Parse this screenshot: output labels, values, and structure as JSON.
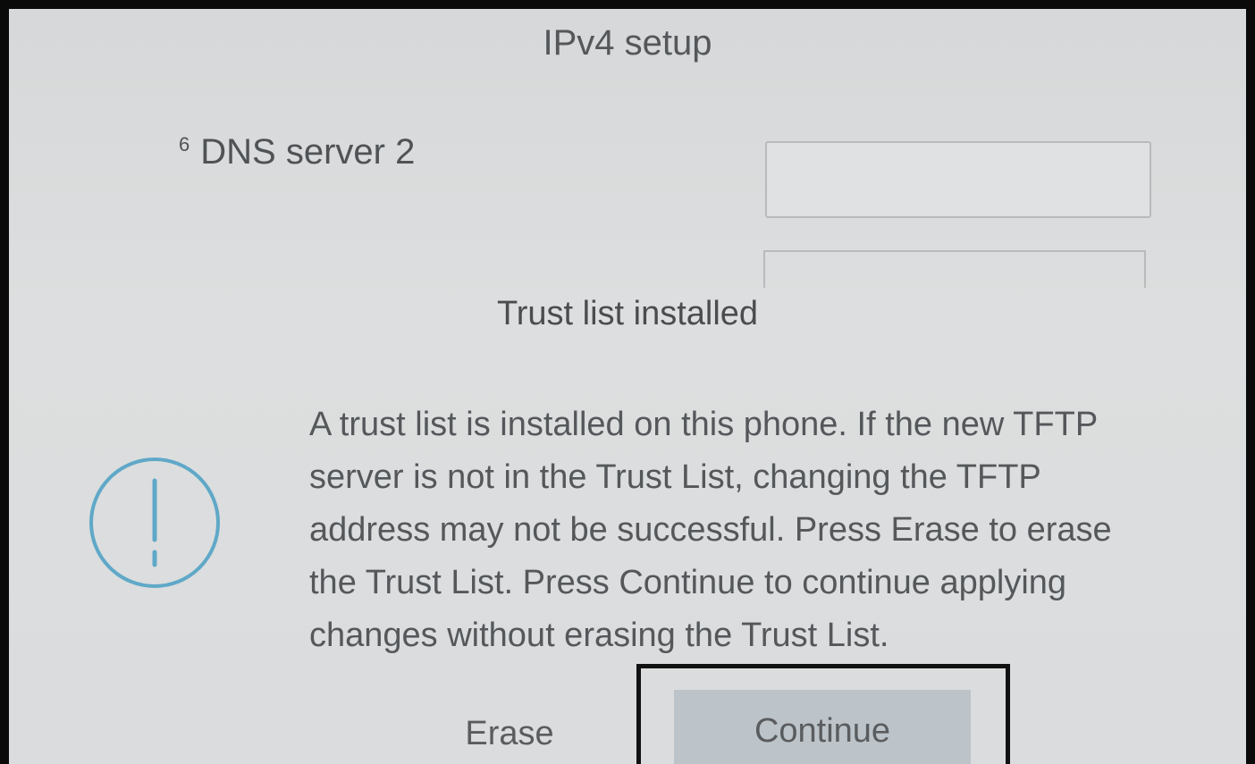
{
  "header": {
    "title": "IPv4 setup"
  },
  "field": {
    "index": "6",
    "label": "DNS server 2",
    "value": ""
  },
  "dialog": {
    "title": "Trust list installed",
    "lines": [
      "A trust list is installed on this phone. If the new TFTP",
      "server is not in the Trust List, changing the TFTP",
      "address may not be successful. Press Erase to erase",
      "the Trust List. Press Continue to continue applying",
      "changes without erasing the Trust List."
    ],
    "icon": "exclamation-circle-icon",
    "accent_color": "#5fa8c8",
    "buttons": {
      "erase_label": "Erase",
      "continue_label": "Continue",
      "focused": "Continue"
    }
  }
}
